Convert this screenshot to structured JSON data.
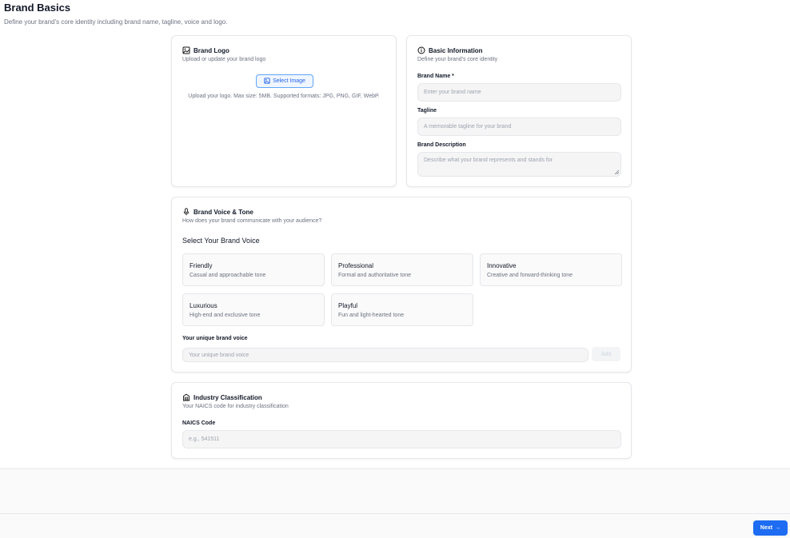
{
  "page": {
    "title": "Brand Basics",
    "subtitle": "Define your brand's core identity including brand name, tagline, voice and logo."
  },
  "logo_card": {
    "title": "Brand Logo",
    "subtitle": "Upload or update your brand logo",
    "select_label": "Select Image",
    "help": "Upload your logo. Max size: 5MB. Supported formats: JPG, PNG, GIF, WebP."
  },
  "basic_card": {
    "title": "Basic Information",
    "subtitle": "Define your brand's core identity",
    "name_label": "Brand Name *",
    "name_placeholder": "Enter your brand name",
    "tagline_label": "Tagline",
    "tagline_placeholder": "A memorable tagline for your brand",
    "description_label": "Brand Description",
    "description_placeholder": "Describe what your brand represents and stands for"
  },
  "voice_card": {
    "title": "Brand Voice & Tone",
    "subtitle": "How does your brand communicate with your audience?",
    "select_heading": "Select Your Brand Voice",
    "options": [
      {
        "title": "Friendly",
        "desc": "Casual and approachable tone"
      },
      {
        "title": "Professional",
        "desc": "Formal and authoritative tone"
      },
      {
        "title": "Innovative",
        "desc": "Creative and forward-thinking tone"
      },
      {
        "title": "Luxurious",
        "desc": "High-end and exclusive tone"
      },
      {
        "title": "Playful",
        "desc": "Fun and light-hearted tone"
      }
    ],
    "custom_label": "Your unique brand voice",
    "custom_placeholder": "Your unique brand voice",
    "add_label": "Add"
  },
  "industry_card": {
    "title": "Industry Classification",
    "subtitle": "Your NAICS code for industry classification",
    "naics_label": "NAICS Code",
    "naics_placeholder": "e.g., 541511"
  },
  "footer": {
    "next_label": "Next",
    "next_arrow": "→"
  },
  "colors": {
    "primary": "#1d6cf2",
    "accent_border": "#60a5fa",
    "muted_text": "#6b7280",
    "input_bg": "#f5f5f5"
  }
}
